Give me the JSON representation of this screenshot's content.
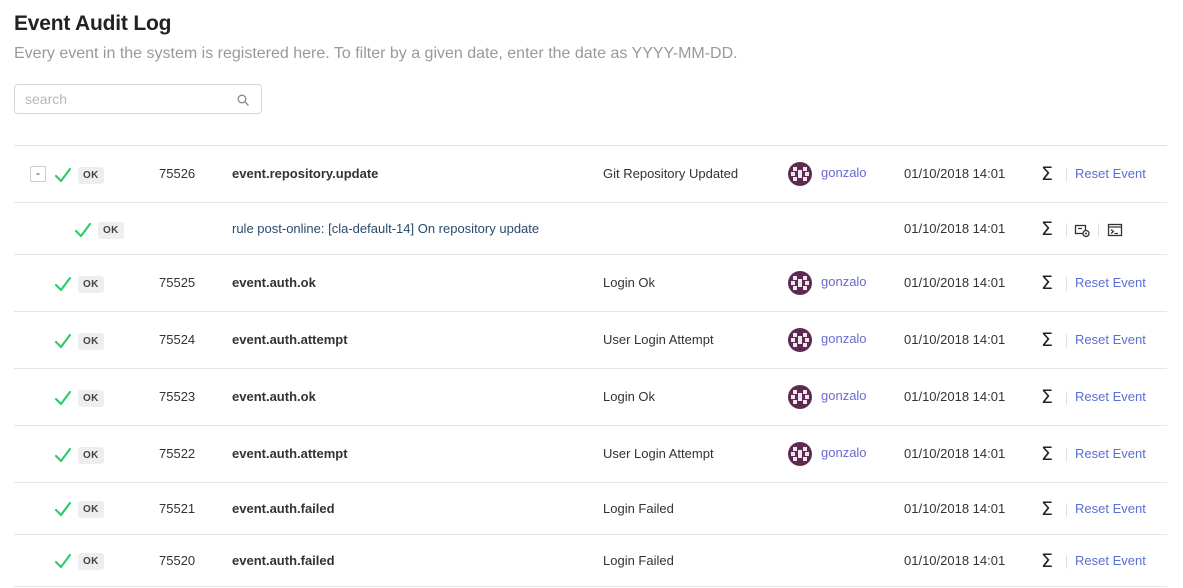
{
  "header": {
    "title": "Event Audit Log",
    "subtitle": "Every event in the system is registered here. To filter by a given date, enter the date as YYYY-MM-DD."
  },
  "search": {
    "placeholder": "search",
    "value": ""
  },
  "colors": {
    "ok_check": "#2ecc71",
    "link": "#5a6fd4",
    "user_link": "#6a6acf",
    "avatar_bg": "#5d2a52",
    "badge_bg": "#eeeeee"
  },
  "icons": [
    "search-icon",
    "checkmark-icon",
    "sigma-icon",
    "rule-icon",
    "terminal-icon",
    "avatar"
  ],
  "rows": [
    {
      "expand": "-",
      "status": "OK",
      "id": "75526",
      "event": "event.repository.update",
      "description": "Git Repository Updated",
      "user": "gonzalo",
      "date": "01/10/2018 14:01",
      "action": "Reset Event"
    },
    {
      "status": "OK",
      "rule": "rule post-online: [cla-default-14] On repository update",
      "date": "01/10/2018 14:01"
    },
    {
      "status": "OK",
      "id": "75525",
      "event": "event.auth.ok",
      "description": "Login Ok",
      "user": "gonzalo",
      "date": "01/10/2018 14:01",
      "action": "Reset Event"
    },
    {
      "status": "OK",
      "id": "75524",
      "event": "event.auth.attempt",
      "description": "User Login Attempt",
      "user": "gonzalo",
      "date": "01/10/2018 14:01",
      "action": "Reset Event"
    },
    {
      "status": "OK",
      "id": "75523",
      "event": "event.auth.ok",
      "description": "Login Ok",
      "user": "gonzalo",
      "date": "01/10/2018 14:01",
      "action": "Reset Event"
    },
    {
      "status": "OK",
      "id": "75522",
      "event": "event.auth.attempt",
      "description": "User Login Attempt",
      "user": "gonzalo",
      "date": "01/10/2018 14:01",
      "action": "Reset Event"
    },
    {
      "status": "OK",
      "id": "75521",
      "event": "event.auth.failed",
      "description": "Login Failed",
      "date": "01/10/2018 14:01",
      "action": "Reset Event"
    },
    {
      "status": "OK",
      "id": "75520",
      "event": "event.auth.failed",
      "description": "Login Failed",
      "date": "01/10/2018 14:01",
      "action": "Reset Event"
    }
  ]
}
